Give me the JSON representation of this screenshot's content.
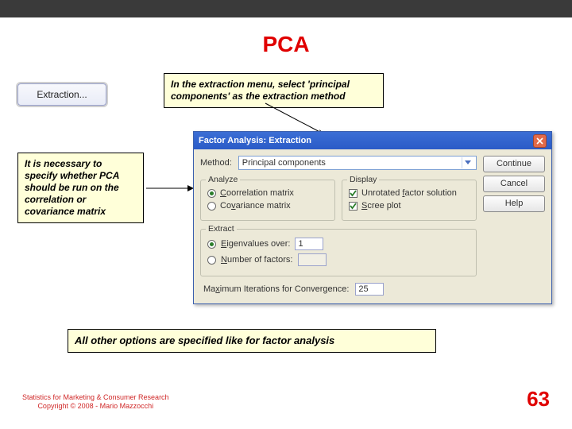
{
  "slide": {
    "title": "PCA",
    "callout_top": "In the extraction menu, select 'principal components' as the extraction method",
    "callout_left": "It is necessary to specify whether PCA should be run on the correlation or covariance matrix",
    "callout_bottom": "All other options are specified like for factor analysis",
    "extraction_button": "Extraction...",
    "footer_line1": "Statistics for Marketing & Consumer Research",
    "footer_line2": "Copyright © 2008 - Mario Mazzocchi",
    "page_number": "63"
  },
  "dialog": {
    "title": "Factor Analysis: Extraction",
    "method_label": "Method:",
    "method_value": "Principal components",
    "analyze_title": "Analyze",
    "opt_correlation": "Correlation matrix",
    "opt_covariance": "Covariance matrix",
    "display_title": "Display",
    "opt_unrotated": "Unrotated factor solution",
    "opt_scree": "Scree plot",
    "extract_title": "Extract",
    "opt_eigen": "Eigenvalues over:",
    "eigen_value": "1",
    "opt_nfactors": "Number of factors:",
    "iter_label": "Maximum Iterations for Convergence:",
    "iter_value": "25",
    "btn_continue": "Continue",
    "btn_cancel": "Cancel",
    "btn_help": "Help"
  }
}
